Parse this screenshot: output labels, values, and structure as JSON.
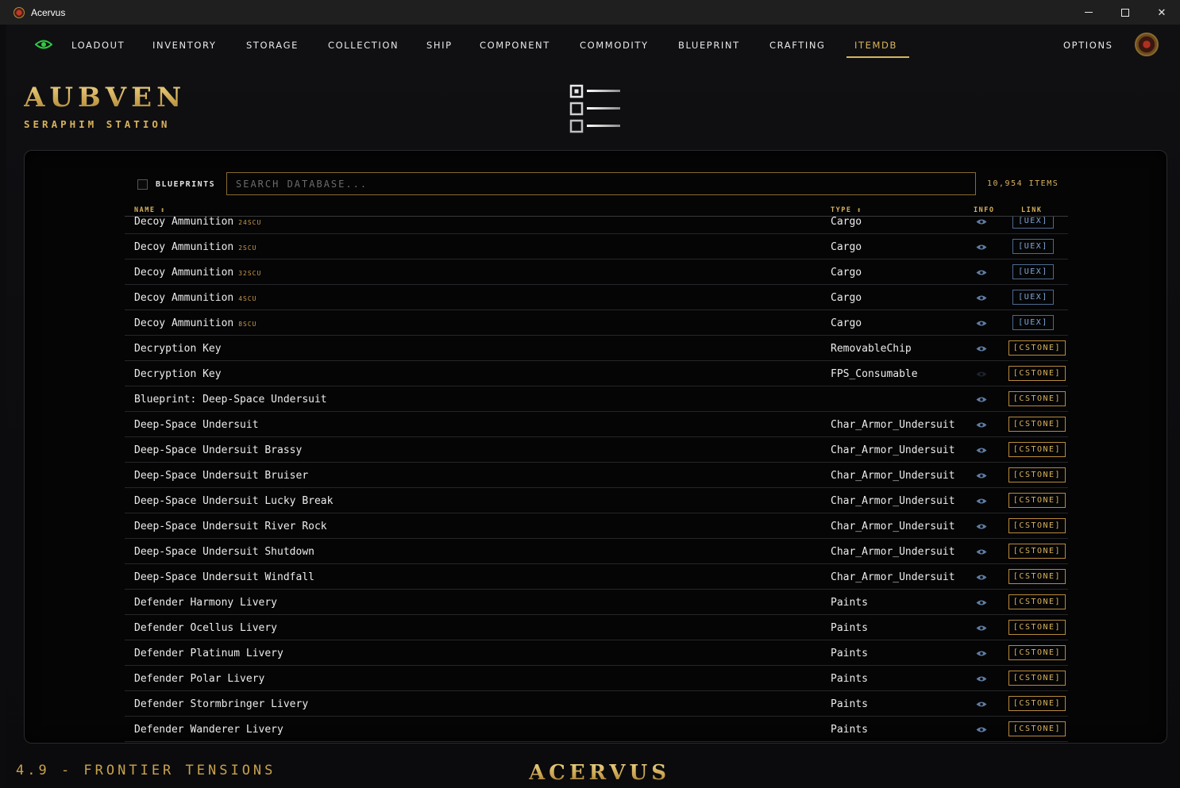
{
  "window": {
    "title": "Acervus"
  },
  "nav": {
    "items": [
      "LOADOUT",
      "INVENTORY",
      "STORAGE",
      "COLLECTION",
      "SHIP",
      "COMPONENT",
      "COMMODITY",
      "BLUEPRINT",
      "CRAFTING",
      "ITEMDB"
    ],
    "active": "ITEMDB",
    "options_label": "OPTIONS"
  },
  "location": {
    "name": "AUBVEN",
    "station": "SERAPHIM STATION"
  },
  "filters": {
    "blueprints_label": "BLUEPRINTS",
    "blueprints_checked": false,
    "search_placeholder": "SEARCH DATABASE...",
    "search_value": "",
    "items_count": "10,954 ITEMS"
  },
  "table": {
    "headers": {
      "name": "NAME ↕",
      "type": "TYPE ↕",
      "info": "INFO",
      "link": "LINK"
    },
    "rows": [
      {
        "name": "Decoy Ammunition",
        "size": "24SCU",
        "type": "Cargo",
        "link": "[UEX]",
        "info_visible": true
      },
      {
        "name": "Decoy Ammunition",
        "size": "2SCU",
        "type": "Cargo",
        "link": "[UEX]",
        "info_visible": true
      },
      {
        "name": "Decoy Ammunition",
        "size": "32SCU",
        "type": "Cargo",
        "link": "[UEX]",
        "info_visible": true
      },
      {
        "name": "Decoy Ammunition",
        "size": "4SCU",
        "type": "Cargo",
        "link": "[UEX]",
        "info_visible": true
      },
      {
        "name": "Decoy Ammunition",
        "size": "8SCU",
        "type": "Cargo",
        "link": "[UEX]",
        "info_visible": true
      },
      {
        "name": "Decryption Key",
        "size": "",
        "type": "RemovableChip",
        "link": "[CSTONE]",
        "info_visible": true
      },
      {
        "name": "Decryption Key",
        "size": "",
        "type": "FPS_Consumable",
        "link": "[CSTONE]",
        "info_visible": false
      },
      {
        "name": "Blueprint: Deep-Space Undersuit",
        "size": "",
        "type": "",
        "link": "[CSTONE]",
        "info_visible": true
      },
      {
        "name": "Deep-Space Undersuit",
        "size": "",
        "type": "Char_Armor_Undersuit",
        "link": "[CSTONE]",
        "info_visible": true
      },
      {
        "name": "Deep-Space Undersuit Brassy",
        "size": "",
        "type": "Char_Armor_Undersuit",
        "link": "[CSTONE]",
        "info_visible": true
      },
      {
        "name": "Deep-Space Undersuit Bruiser",
        "size": "",
        "type": "Char_Armor_Undersuit",
        "link": "[CSTONE]",
        "info_visible": true
      },
      {
        "name": "Deep-Space Undersuit Lucky Break",
        "size": "",
        "type": "Char_Armor_Undersuit",
        "link": "[CSTONE]",
        "info_visible": true
      },
      {
        "name": "Deep-Space Undersuit River Rock",
        "size": "",
        "type": "Char_Armor_Undersuit",
        "link": "[CSTONE]",
        "info_visible": true
      },
      {
        "name": "Deep-Space Undersuit Shutdown",
        "size": "",
        "type": "Char_Armor_Undersuit",
        "link": "[CSTONE]",
        "info_visible": true
      },
      {
        "name": "Deep-Space Undersuit Windfall",
        "size": "",
        "type": "Char_Armor_Undersuit",
        "link": "[CSTONE]",
        "info_visible": true
      },
      {
        "name": "Defender Harmony Livery",
        "size": "",
        "type": "Paints",
        "link": "[CSTONE]",
        "info_visible": true
      },
      {
        "name": "Defender Ocellus Livery",
        "size": "",
        "type": "Paints",
        "link": "[CSTONE]",
        "info_visible": true
      },
      {
        "name": "Defender Platinum Livery",
        "size": "",
        "type": "Paints",
        "link": "[CSTONE]",
        "info_visible": true
      },
      {
        "name": "Defender Polar Livery",
        "size": "",
        "type": "Paints",
        "link": "[CSTONE]",
        "info_visible": true
      },
      {
        "name": "Defender Stormbringer Livery",
        "size": "",
        "type": "Paints",
        "link": "[CSTONE]",
        "info_visible": true
      },
      {
        "name": "Defender Wanderer Livery",
        "size": "",
        "type": "Paints",
        "link": "[CSTONE]",
        "info_visible": true
      }
    ]
  },
  "footer": {
    "version": "4.9 - FRONTIER TENSIONS",
    "brand": "ACERVUS"
  },
  "colors": {
    "gold": "#d7b15c",
    "uex_blue": "#7fa6d6",
    "eye_green": "#2ecc40",
    "background": "#0c0c0e"
  },
  "icons": {
    "nav_toggle": "eye-icon",
    "info": "eye-icon",
    "header": "checklist-icon"
  }
}
